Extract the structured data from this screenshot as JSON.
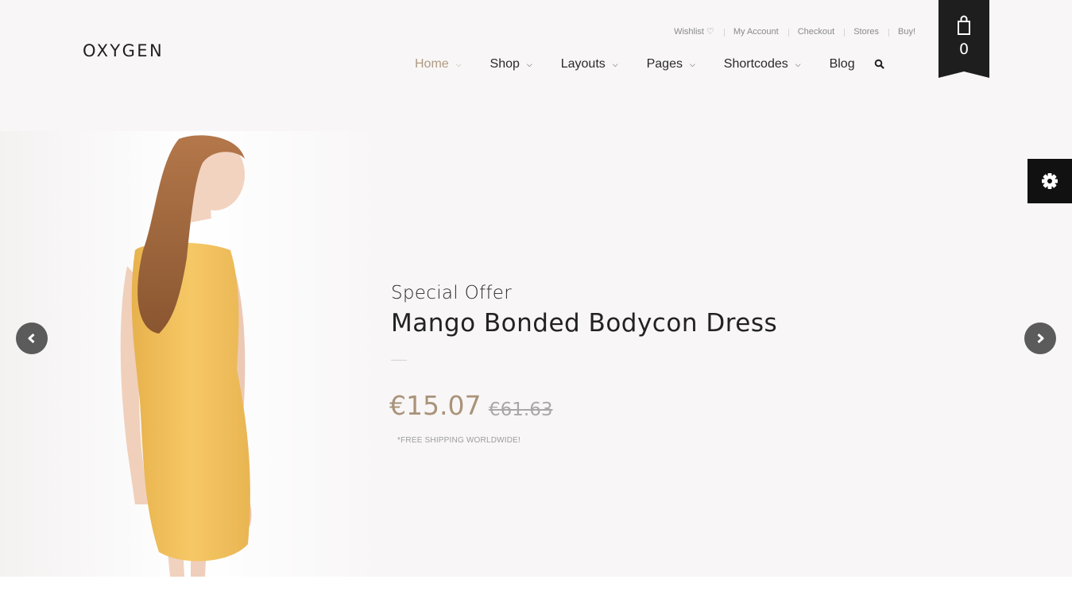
{
  "brand": {
    "logo": "OXYGEN"
  },
  "top_links": [
    {
      "label": "Wishlist",
      "icon": "heart-outline-icon"
    },
    {
      "label": "My Account"
    },
    {
      "label": "Checkout"
    },
    {
      "label": "Stores"
    },
    {
      "label": "Buy!"
    }
  ],
  "nav": {
    "items": [
      {
        "label": "Home",
        "active": true
      },
      {
        "label": "Shop"
      },
      {
        "label": "Layouts"
      },
      {
        "label": "Pages"
      },
      {
        "label": "Shortcodes"
      },
      {
        "label": "Blog"
      }
    ],
    "search_icon": "search-icon"
  },
  "cart": {
    "count": "0",
    "icon": "shopping-bag-icon"
  },
  "slide": {
    "kicker": "Special Offer",
    "title": "Mango Bonded Bodycon Dress",
    "price": "€15.07",
    "old_price": "€61.63",
    "note": "*FREE SHIPPING WORLDWIDE!"
  },
  "colors": {
    "accent": "#b09a82",
    "price": "#a9937a",
    "cart_bg": "#1e1e1e",
    "dress": "#f3c35e",
    "page_bg": "#f8f6f6"
  }
}
